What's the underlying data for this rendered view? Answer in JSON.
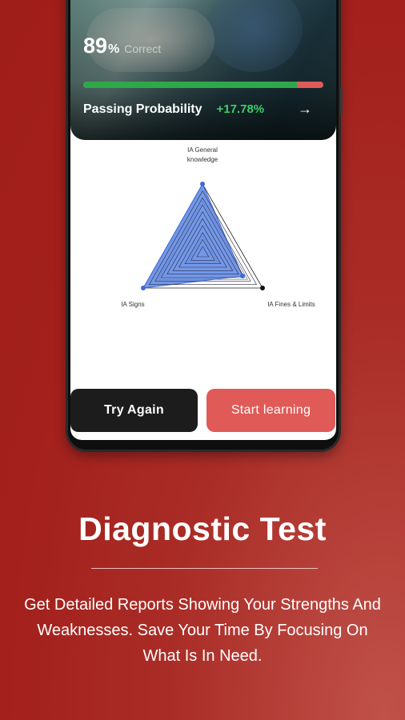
{
  "hero": {
    "score_value": "89",
    "score_unit": "%",
    "score_label": "Correct",
    "progress_fraction": 0.89,
    "passing_label": "Passing Probability",
    "passing_value": "+17.78%",
    "arrow_glyph": "→"
  },
  "radar": {
    "axes": [
      {
        "label_line1": "IA General",
        "label_line2": "knowledge"
      },
      {
        "label": "IA Signs"
      },
      {
        "label": "IA Fines & Limits"
      }
    ]
  },
  "buttons": {
    "try_again": "Try Again",
    "start_learning": "Start learning"
  },
  "marketing": {
    "title": "Diagnostic Test",
    "description": "Get Detailed Reports Showing Your Strengths And Weaknesses. Save Your Time By Focusing On What Is In Need."
  },
  "colors": {
    "background": "#a3201c",
    "accent_green": "#2fa84a",
    "accent_red": "#e05a57",
    "radar_fill": "#5b86e5"
  }
}
